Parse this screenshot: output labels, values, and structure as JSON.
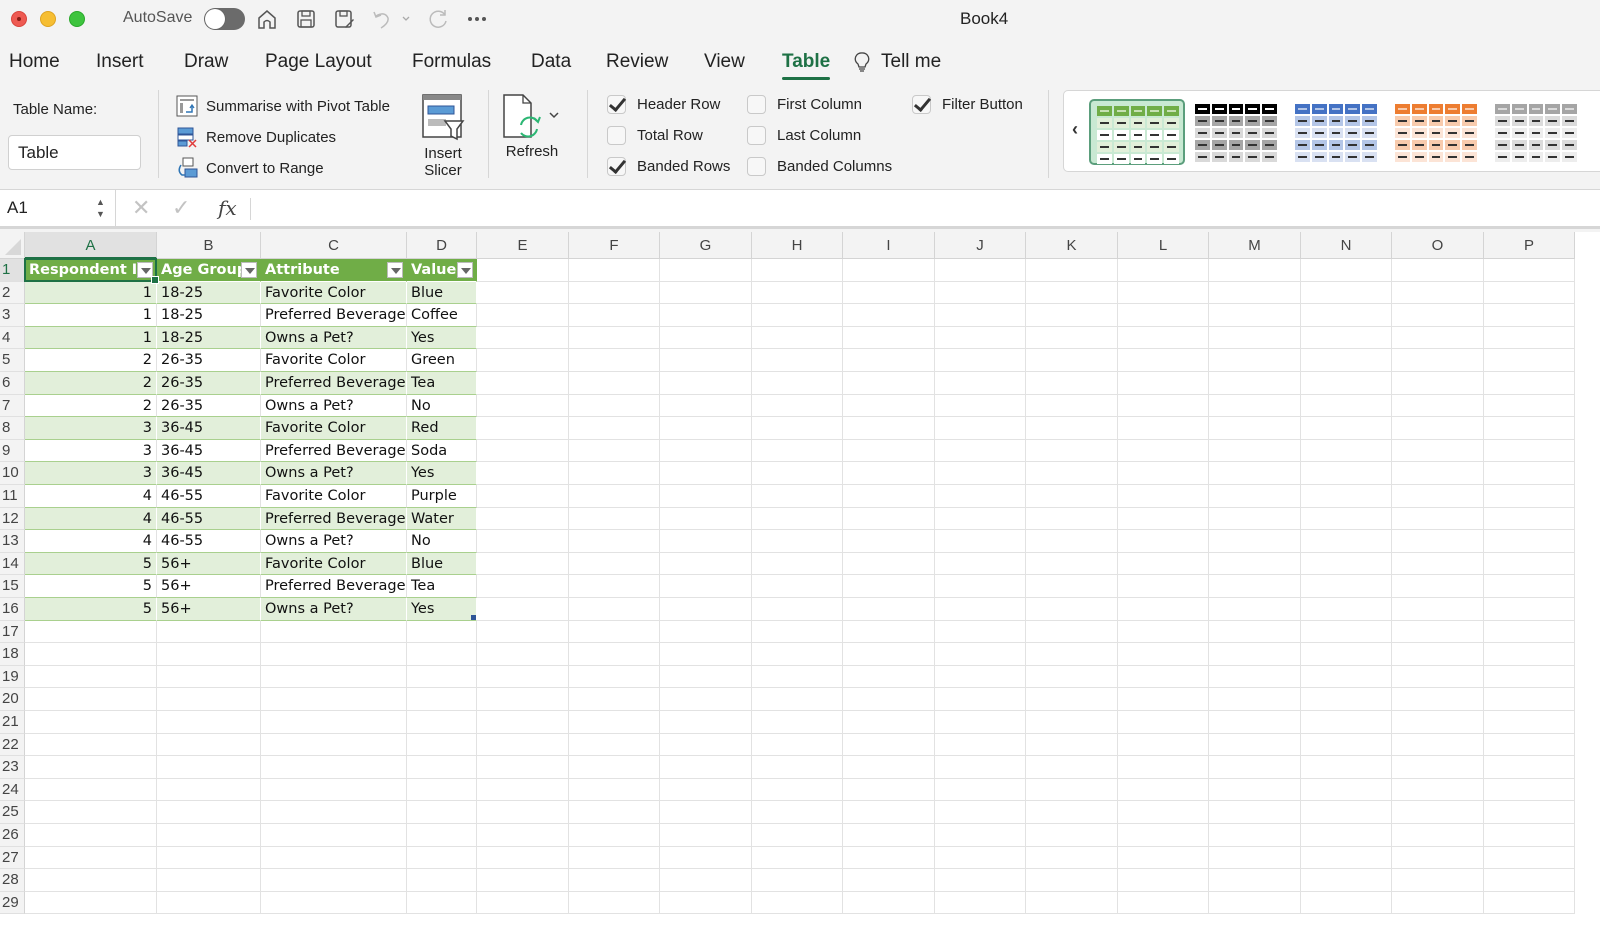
{
  "window": {
    "title": "Book4",
    "autosave_label": "AutoSave",
    "autosave_on": false
  },
  "quick_access": [
    {
      "name": "home-icon"
    },
    {
      "name": "save-icon"
    },
    {
      "name": "save-as-icon"
    },
    {
      "name": "undo-icon"
    },
    {
      "name": "redo-icon"
    },
    {
      "name": "more-icon"
    }
  ],
  "tabs": [
    {
      "label": "Home"
    },
    {
      "label": "Insert"
    },
    {
      "label": "Draw"
    },
    {
      "label": "Page Layout"
    },
    {
      "label": "Formulas"
    },
    {
      "label": "Data"
    },
    {
      "label": "Review"
    },
    {
      "label": "View"
    },
    {
      "label": "Table",
      "active": true
    },
    {
      "label": "Tell me"
    }
  ],
  "ribbon": {
    "table_name_label": "Table Name:",
    "table_name_value": "Table",
    "tools": {
      "pivot": "Summarise with Pivot Table",
      "remove_duplicates": "Remove Duplicates",
      "convert": "Convert to Range"
    },
    "insert_slicer": [
      "Insert",
      "Slicer"
    ],
    "refresh": "Refresh",
    "options": {
      "header_row": {
        "label": "Header Row",
        "checked": true
      },
      "total_row": {
        "label": "Total Row",
        "checked": false
      },
      "banded_rows": {
        "label": "Banded Rows",
        "checked": true
      },
      "first_column": {
        "label": "First Column",
        "checked": false
      },
      "last_column": {
        "label": "Last Column",
        "checked": false
      },
      "banded_columns": {
        "label": "Banded Columns",
        "checked": false
      },
      "filter_button": {
        "label": "Filter Button",
        "checked": true
      }
    },
    "table_styles": [
      {
        "name": "green",
        "header": "#70ad47",
        "band": "#e2efda",
        "plain": "#ffffff",
        "dash_header": "#c6e0b4",
        "dash": "#333333",
        "selected": true
      },
      {
        "name": "black",
        "header": "#000000",
        "band": "#a6a6a6",
        "plain": "#d9d9d9",
        "dash_header": "#ffffff",
        "dash": "#333333",
        "selected": false
      },
      {
        "name": "blue",
        "header": "#4472c4",
        "band": "#b4c6e7",
        "plain": "#d9e1f2",
        "dash_header": "#b4c6e7",
        "dash": "#333333",
        "selected": false
      },
      {
        "name": "orange",
        "header": "#ed7d31",
        "band": "#f8cbad",
        "plain": "#fce4d6",
        "dash_header": "#f8cbad",
        "dash": "#333333",
        "selected": false
      },
      {
        "name": "gray",
        "header": "#a5a5a5",
        "band": "#dbdbdb",
        "plain": "#ededed",
        "dash_header": "#dbdbdb",
        "dash": "#333333",
        "selected": false
      }
    ]
  },
  "formula_bar": {
    "name_box": "A1",
    "formula": "",
    "fx_label": "fx"
  },
  "sheet": {
    "columns": [
      "A",
      "B",
      "C",
      "D",
      "E",
      "F",
      "G",
      "H",
      "I",
      "J",
      "K",
      "L",
      "M",
      "N",
      "O",
      "P"
    ],
    "selected_column": "A",
    "row_numbers": [
      "1",
      "2",
      "3",
      "4",
      "5",
      "6",
      "7",
      "8",
      "9",
      "10",
      "11",
      "12",
      "13",
      "14",
      "15",
      "16",
      "17",
      "18",
      "19",
      "20",
      "21",
      "22",
      "23",
      "24",
      "25",
      "26",
      "27",
      "28",
      "29"
    ],
    "selected_row": "1",
    "table": {
      "headers": [
        "Respondent ID",
        "Age Group",
        "Attribute",
        "Value"
      ],
      "rows": [
        [
          "1",
          "18-25",
          "Favorite Color",
          "Blue"
        ],
        [
          "1",
          "18-25",
          "Preferred Beverage",
          "Coffee"
        ],
        [
          "1",
          "18-25",
          "Owns a Pet?",
          "Yes"
        ],
        [
          "2",
          "26-35",
          "Favorite Color",
          "Green"
        ],
        [
          "2",
          "26-35",
          "Preferred Beverage",
          "Tea"
        ],
        [
          "2",
          "26-35",
          "Owns a Pet?",
          "No"
        ],
        [
          "3",
          "36-45",
          "Favorite Color",
          "Red"
        ],
        [
          "3",
          "36-45",
          "Preferred Beverage",
          "Soda"
        ],
        [
          "3",
          "36-45",
          "Owns a Pet?",
          "Yes"
        ],
        [
          "4",
          "46-55",
          "Favorite Color",
          "Purple"
        ],
        [
          "4",
          "46-55",
          "Preferred Beverage",
          "Water"
        ],
        [
          "4",
          "46-55",
          "Owns a Pet?",
          "No"
        ],
        [
          "5",
          "56+",
          "Favorite Color",
          "Blue"
        ],
        [
          "5",
          "56+",
          "Preferred Beverage",
          "Tea"
        ],
        [
          "5",
          "56+",
          "Owns a Pet?",
          "Yes"
        ]
      ]
    },
    "colors": {
      "header_fill": "#70ad47",
      "band_fill": "#e2efda",
      "accent": "#1e7145"
    }
  }
}
